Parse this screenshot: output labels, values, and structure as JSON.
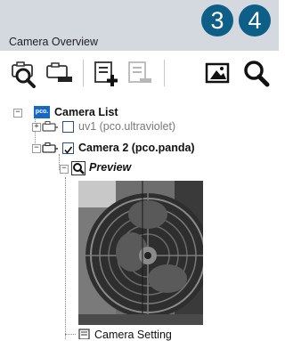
{
  "panel": {
    "title": "Camera Overview"
  },
  "badges": [
    "3",
    "4"
  ],
  "toolbar": {
    "buttons": [
      {
        "name": "camera-search",
        "icon": "camera-magnifier-icon",
        "enabled": true
      },
      {
        "name": "camera-remove",
        "icon": "camera-minus-icon",
        "enabled": true
      },
      {
        "name": "add-item",
        "icon": "list-add-icon",
        "enabled": true
      },
      {
        "name": "remove-item",
        "icon": "list-remove-icon",
        "enabled": false
      },
      {
        "name": "image",
        "icon": "picture-icon",
        "enabled": true
      },
      {
        "name": "zoom",
        "icon": "magnifier-icon",
        "enabled": true
      }
    ]
  },
  "tree": {
    "root": {
      "logo": "pco.",
      "label": "Camera List"
    },
    "cameras": [
      {
        "label": "uv1 (pco.ultraviolet)",
        "checked": false,
        "expanded": false,
        "dimmed": true
      },
      {
        "label": "Camera 2 (pco.panda)",
        "checked": true,
        "expanded": true,
        "dimmed": false
      }
    ],
    "preview": {
      "label": "Preview"
    },
    "settings": {
      "label": "Camera Setting"
    }
  }
}
